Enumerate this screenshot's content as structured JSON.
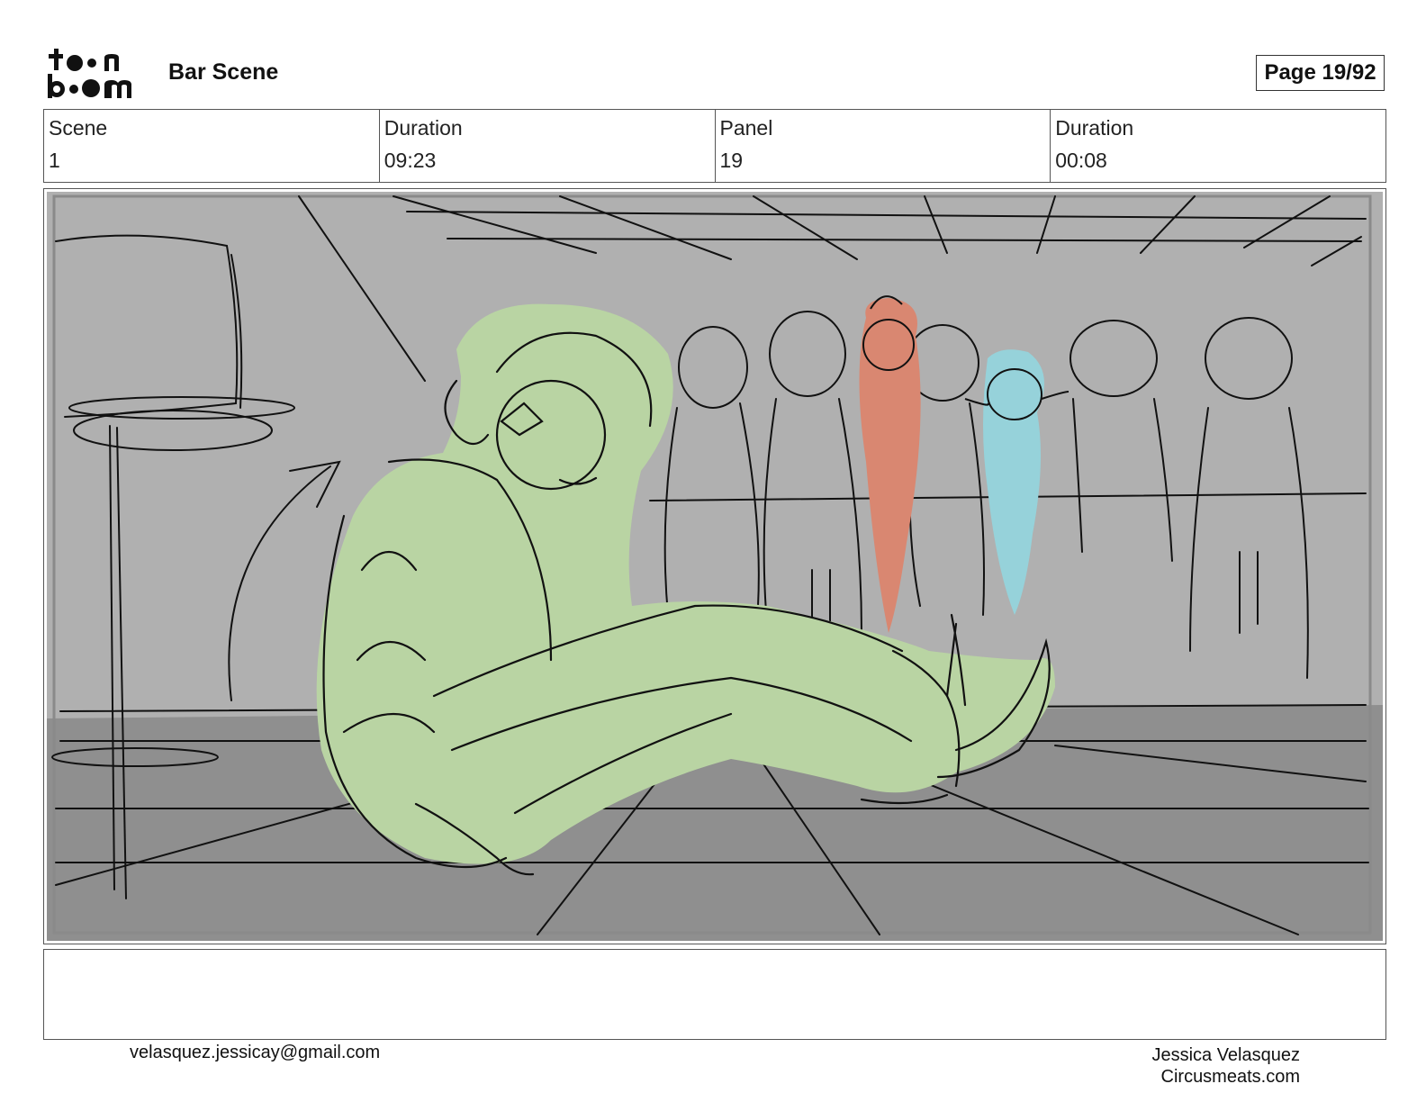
{
  "header": {
    "logo_text": "toon boom",
    "title": "Bar Scene",
    "page_label": "Page 19/92"
  },
  "info": {
    "scene_label": "Scene",
    "scene_value": "1",
    "scene_duration_label": "Duration",
    "scene_duration_value": "09:23",
    "panel_label": "Panel",
    "panel_value": "19",
    "panel_duration_label": "Duration",
    "panel_duration_value": "00:08"
  },
  "panel_image": {
    "colors": {
      "background_wall": "#b0b0b0",
      "floor": "#8f8f8f",
      "character_main": "#b9d4a3",
      "character_red": "#d98771",
      "character_blue": "#96d2da"
    }
  },
  "notes": {
    "text": ""
  },
  "footer": {
    "email": "velasquez.jessicay@gmail.com",
    "author_name": "Jessica Velasquez",
    "author_site": "Circusmeats.com"
  }
}
